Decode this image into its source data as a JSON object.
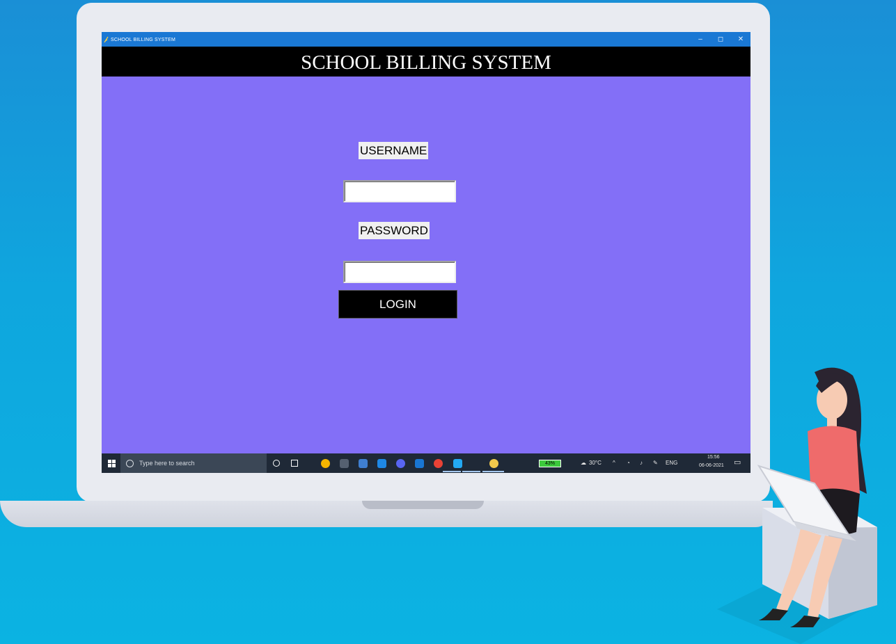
{
  "window": {
    "title": "SCHOOL BILLING SYSTEM",
    "controls": {
      "minimize": "–",
      "maximize": "◻",
      "close": "✕"
    }
  },
  "app": {
    "header": "SCHOOL BILLING SYSTEM",
    "background_color": "#836ff7",
    "username_label": "USERNAME",
    "username_value": "",
    "password_label": "PASSWORD",
    "password_value": "",
    "login_label": "LOGIN"
  },
  "taskbar": {
    "search_placeholder": "Type here to search",
    "battery": "43%",
    "weather": "30°C",
    "language": "ENG",
    "time": "15:56",
    "date": "06-06-2021",
    "pinned_apps": [
      "cortana-icon",
      "task-view-icon",
      "chrome-icon",
      "terminal-icon",
      "python-icon",
      "l-app-icon",
      "discord-icon",
      "mail-icon",
      "chrome-alt-icon",
      "vscode-icon",
      "python-idle-icon"
    ]
  }
}
